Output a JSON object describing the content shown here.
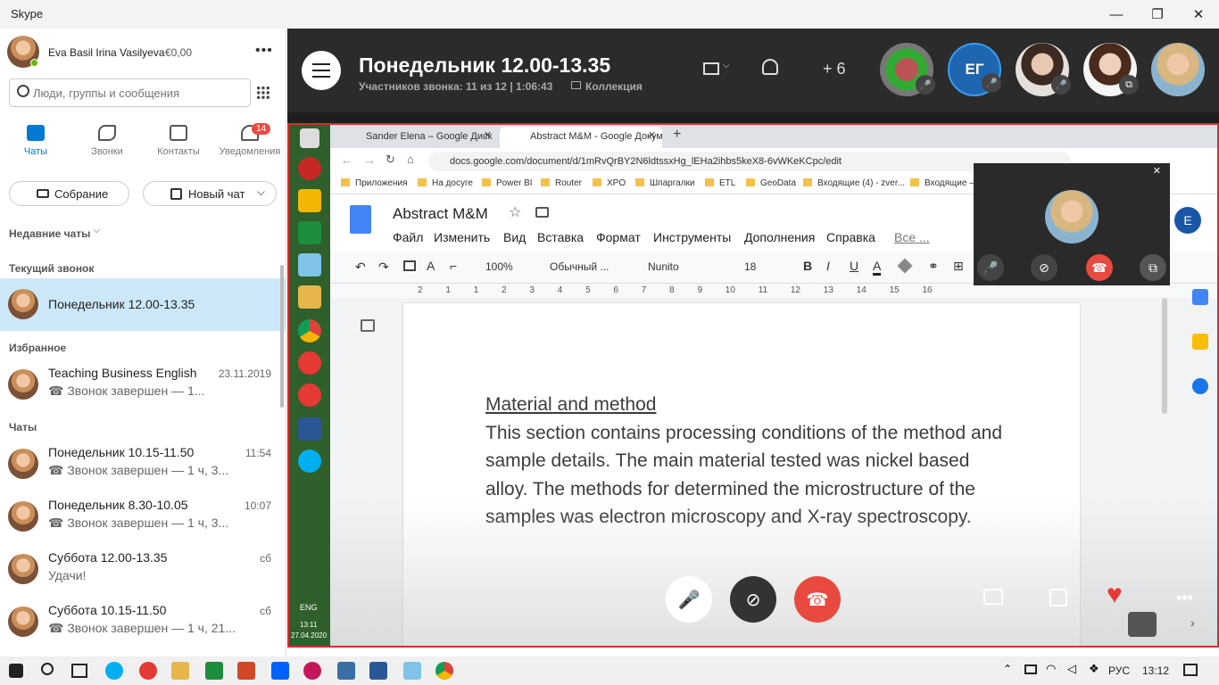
{
  "window": {
    "title": "Skype",
    "controls": [
      "—",
      "❐",
      "✕"
    ]
  },
  "profile": {
    "name": "Eva Basil Irina Vasilyeva",
    "balance": "€0,00",
    "more": "•••"
  },
  "search": {
    "placeholder": "Люди, группы и сообщения"
  },
  "nav": {
    "tabs": [
      {
        "label": "Чаты",
        "active": true
      },
      {
        "label": "Звонки"
      },
      {
        "label": "Контакты"
      },
      {
        "label": "Уведомления",
        "badge": "14"
      }
    ]
  },
  "actions": {
    "meeting": "Собрание",
    "new_chat": "Новый чат"
  },
  "recent": {
    "label": "Недавние чаты"
  },
  "current_call": {
    "label": "Текущий звонок",
    "name": "Понедельник 12.00-13.35"
  },
  "favorites": {
    "label": "Избранное",
    "items": [
      {
        "name": "Teaching Business English",
        "time": "23.11.2019",
        "sub": "☎ Звонок завершен — 1..."
      }
    ]
  },
  "chats": {
    "label": "Чаты",
    "items": [
      {
        "name": "Понедельник 10.15-11.50",
        "time": "11:54",
        "sub": "☎ Звонок завершен — 1 ч, 3..."
      },
      {
        "name": "Понедельник 8.30-10.05",
        "time": "10:07",
        "sub": "☎ Звонок завершен — 1 ч, 3..."
      },
      {
        "name": "Суббота 12.00-13.35",
        "time": "сб",
        "sub": "Удачи!"
      },
      {
        "name": "Суббота 10.15-11.50",
        "time": "сб",
        "sub": "☎ Звонок завершен — 1 ч, 21..."
      }
    ]
  },
  "call": {
    "title": "Понедельник 12.00-13.35",
    "info": "Участников звонка: 11 из 12 | 1:06:43",
    "collection": "Коллекция",
    "more_count": "+ 6",
    "initials": "ЕГ"
  },
  "browser": {
    "tabs": [
      "Sander Elena – Google Диск",
      "Abstract M&M - Google Докум"
    ],
    "url": "docs.google.com/document/d/1mRvQrBY2N6ldtssxHg_lEHa2ihbs5keX8-6vWKeKCpc/edit",
    "bookmarks": [
      "Приложения",
      "На досуге",
      "Power BI",
      "Router",
      "XPO",
      "Шпаргалки",
      "ETL",
      "GeoData",
      "Входящие (4) - zver...",
      "Входящие —"
    ]
  },
  "doc": {
    "title": "Abstract M&M",
    "menu": [
      "Файл",
      "Изменить",
      "Вид",
      "Вставка",
      "Формат",
      "Инструменты",
      "Дополнения",
      "Справка",
      "Все ..."
    ],
    "zoom": "100%",
    "style": "Обычный ...",
    "font": "Nunito",
    "size": "18",
    "user_initial": "E",
    "ruler": [
      "2",
      "1",
      "1",
      "2",
      "3",
      "4",
      "5",
      "6",
      "7",
      "8",
      "9",
      "10",
      "11",
      "12",
      "13",
      "14",
      "15",
      "16",
      "17",
      "18"
    ],
    "heading": "Material and method",
    "body": "This section contains processing conditions of the method and sample details. The main material tested was nickel based alloy. The methods for determined the microstructure of the samples was electron microscopy and X-ray spectroscopy."
  },
  "shared_taskbar": {
    "lang": "ENG",
    "time": "13:11",
    "date": "27.04.2020"
  },
  "taskbar": {
    "lang": "РУС",
    "time": "13:12"
  },
  "colors": {
    "accent": "#0078d4",
    "end_call": "#e84a3f",
    "border": "#d32f2f"
  }
}
